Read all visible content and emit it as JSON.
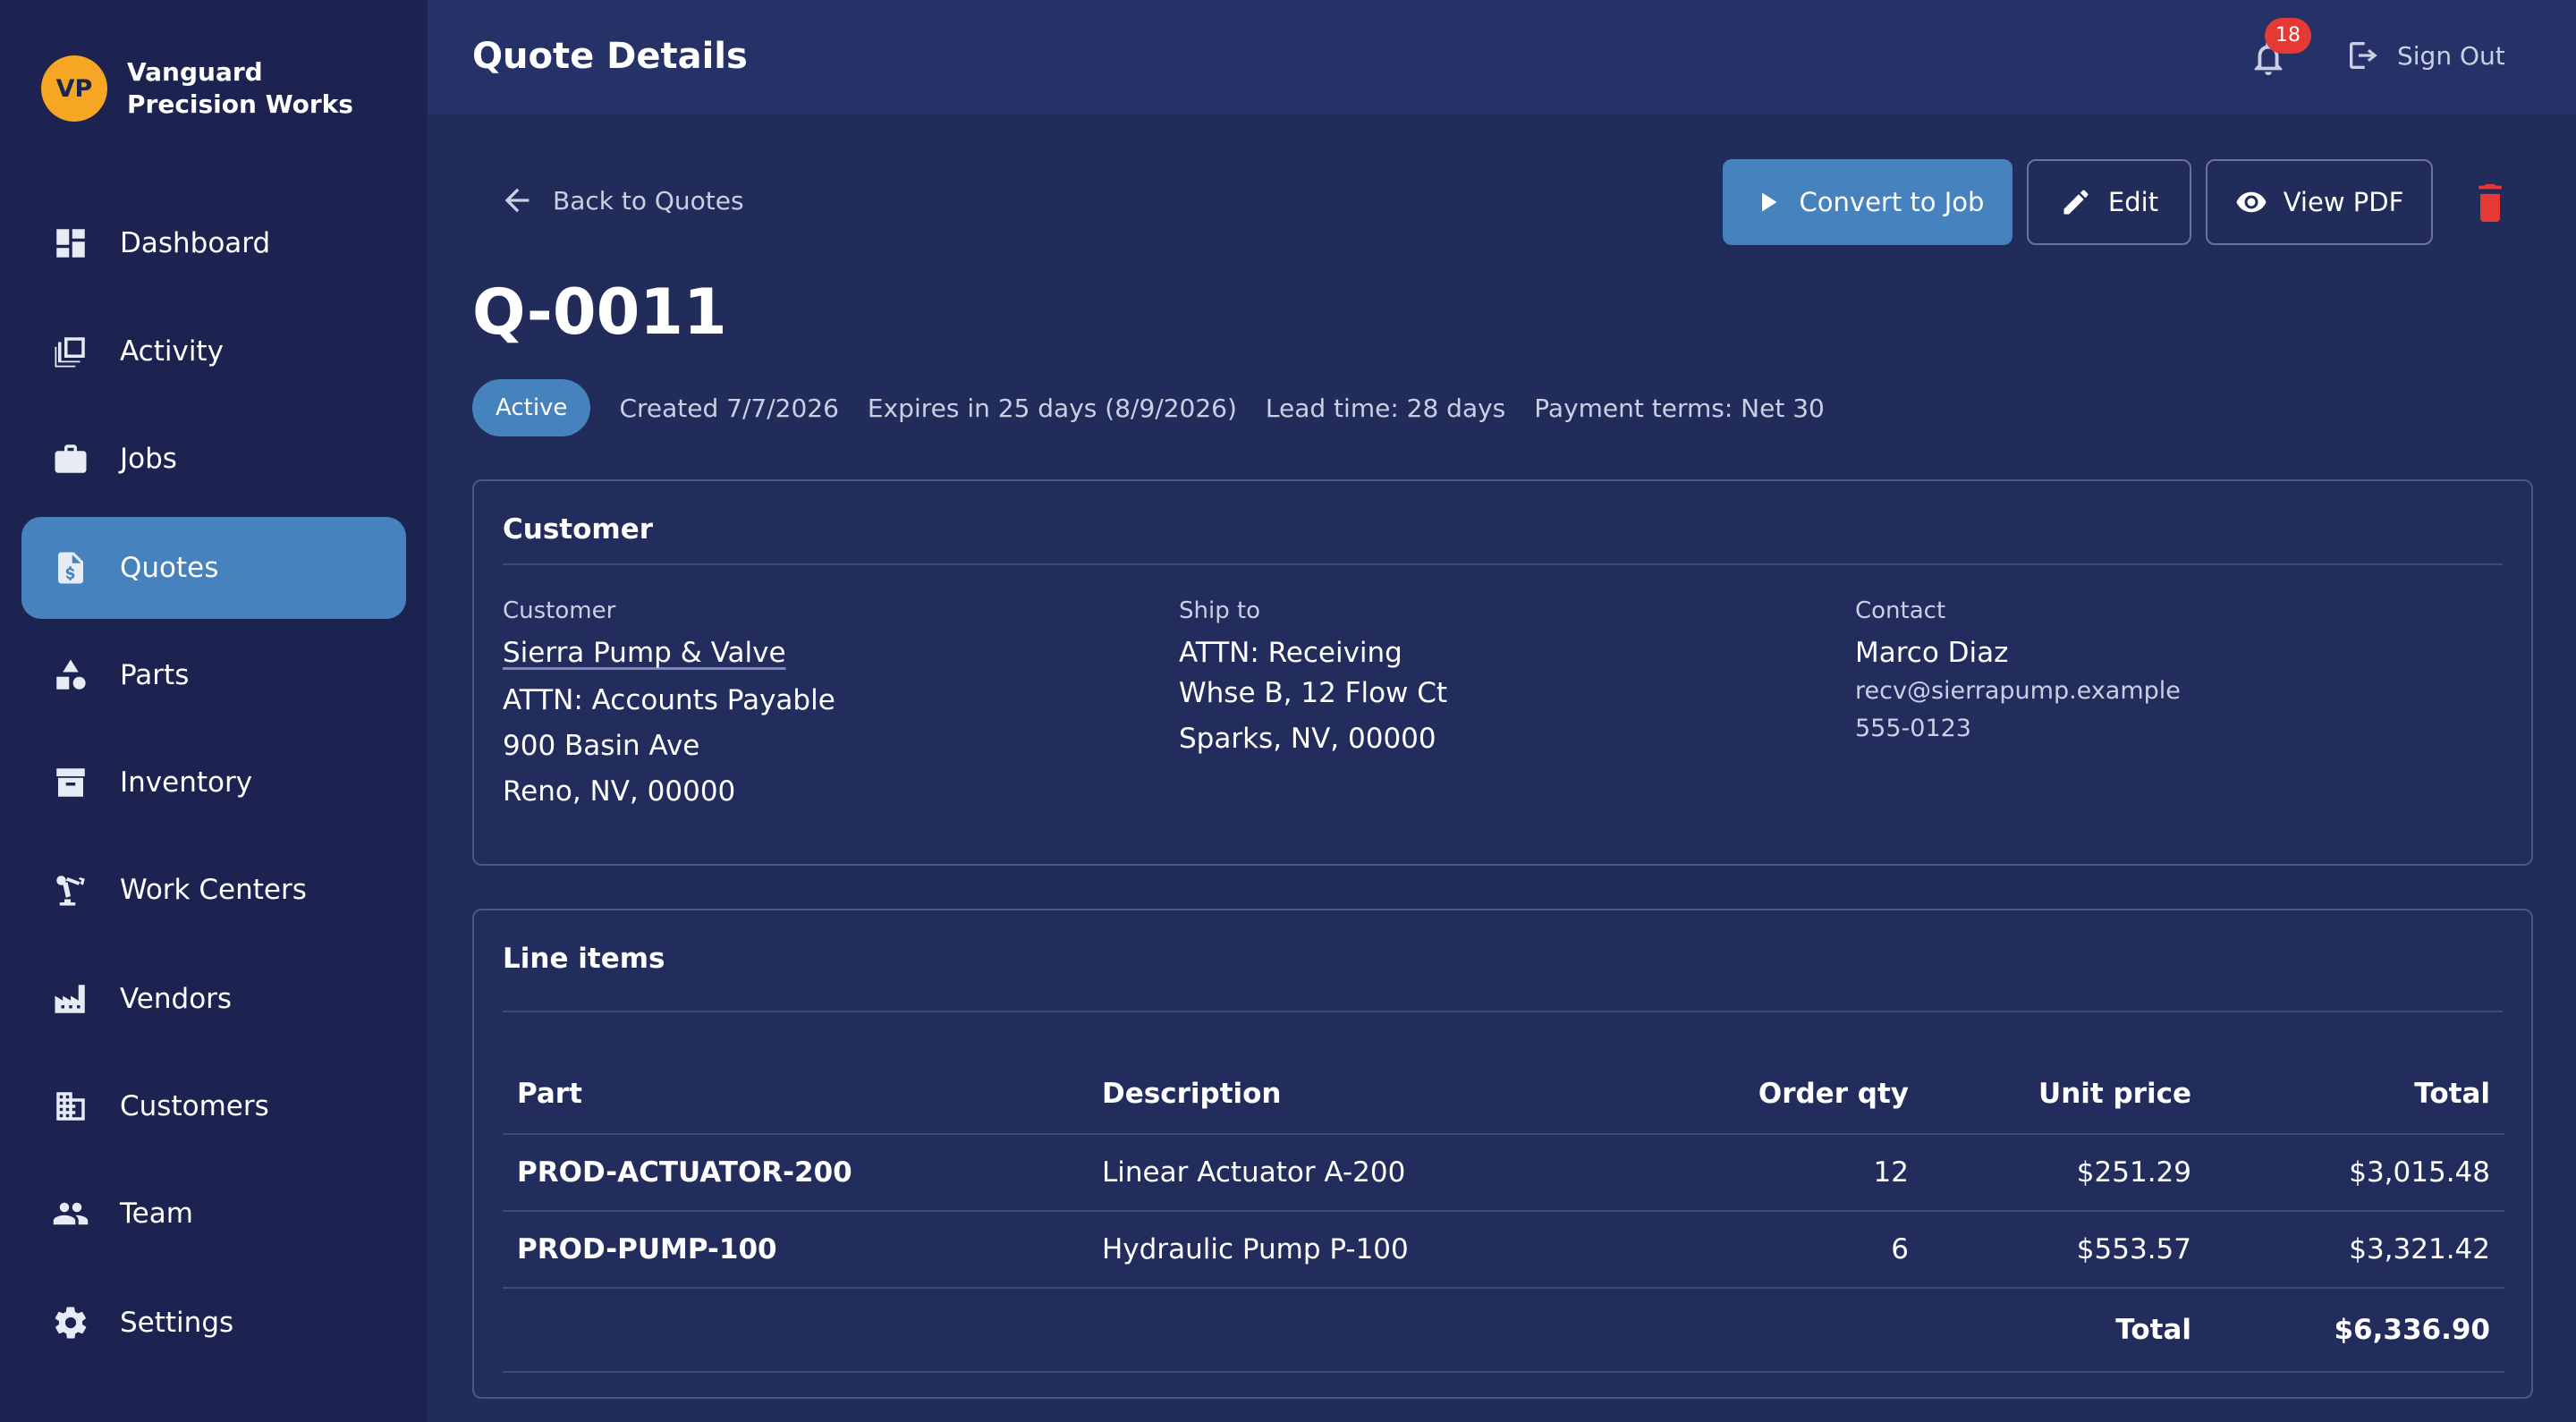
{
  "company": {
    "initials": "VP",
    "name": "Vanguard Precision Works"
  },
  "sidebar": {
    "items": [
      {
        "label": "Dashboard",
        "icon": "dashboard-icon"
      },
      {
        "label": "Activity",
        "icon": "activity-icon"
      },
      {
        "label": "Jobs",
        "icon": "briefcase-icon"
      },
      {
        "label": "Quotes",
        "icon": "quote-document-icon",
        "active": true
      },
      {
        "label": "Parts",
        "icon": "shapes-icon"
      },
      {
        "label": "Inventory",
        "icon": "archive-box-icon"
      },
      {
        "label": "Work Centers",
        "icon": "robot-arm-icon"
      },
      {
        "label": "Vendors",
        "icon": "factory-icon"
      },
      {
        "label": "Customers",
        "icon": "building-icon"
      },
      {
        "label": "Team",
        "icon": "people-icon"
      },
      {
        "label": "Settings",
        "icon": "gear-icon"
      }
    ]
  },
  "header": {
    "title": "Quote Details",
    "notification_count": "18",
    "signout_label": "Sign Out"
  },
  "actions": {
    "back_label": "Back to Quotes",
    "convert_label": "Convert to Job",
    "edit_label": "Edit",
    "pdf_label": "View PDF"
  },
  "quote": {
    "number": "Q-0011",
    "status": "Active",
    "created": "Created 7/7/2026",
    "expires": "Expires in 25 days (8/9/2026)",
    "lead_time": "Lead time: 28 days",
    "payment_terms": "Payment terms: Net 30"
  },
  "customer_card": {
    "title": "Customer",
    "customer": {
      "label": "Customer",
      "name": "Sierra Pump & Valve",
      "attn": "ATTN: Accounts Payable",
      "street": "900 Basin Ave",
      "city": "Reno, NV, 00000"
    },
    "ship_to": {
      "label": "Ship to",
      "attn": "ATTN: Receiving",
      "street": "Whse B, 12 Flow Ct",
      "city": "Sparks, NV, 00000"
    },
    "contact": {
      "label": "Contact",
      "name": "Marco Diaz",
      "email": "recv@sierrapump.example",
      "phone": "555-0123"
    }
  },
  "line_items": {
    "title": "Line items",
    "columns": [
      "Part",
      "Description",
      "Order qty",
      "Unit price",
      "Total"
    ],
    "rows": [
      {
        "part": "PROD-ACTUATOR-200",
        "description": "Linear Actuator A-200",
        "qty": "12",
        "unit_price": "$251.29",
        "total": "$3,015.48"
      },
      {
        "part": "PROD-PUMP-100",
        "description": "Hydraulic Pump P-100",
        "qty": "6",
        "unit_price": "$553.57",
        "total": "$3,321.42"
      }
    ],
    "grand_total_label": "Total",
    "grand_total": "$6,336.90"
  },
  "colors": {
    "accent": "#4682bd",
    "sidebar_bg": "#1c2350",
    "avatar": "#f5a623",
    "danger": "#e53935"
  }
}
